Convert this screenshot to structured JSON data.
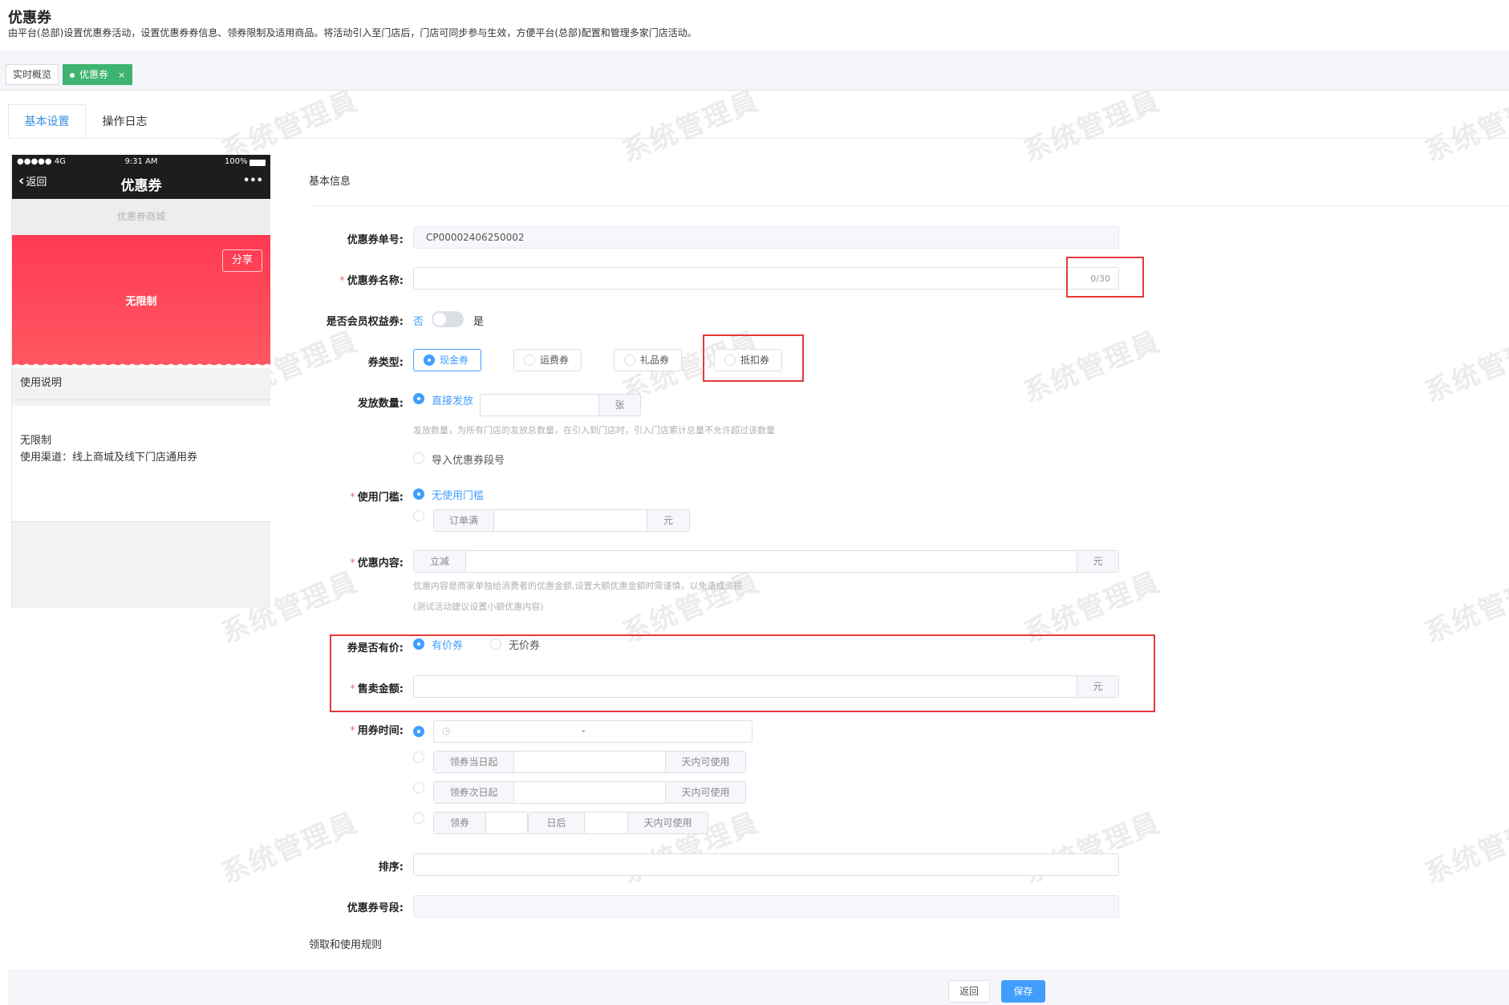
{
  "header": {
    "title": "优惠券",
    "description": "由平台(总部)设置优惠券活动，设置优惠券券信息、领券限制及适用商品。将活动引入至门店后，门店可同步参与生效，方便平台(总部)配置和管理多家门店活动。"
  },
  "view_tabs": [
    {
      "label": "实时概览"
    },
    {
      "label": "优惠券",
      "close": "×"
    }
  ],
  "tabs": [
    "基本设置",
    "操作日志"
  ],
  "watermark": "系统管理員",
  "phone": {
    "carrier": "●●●●● 4G",
    "time": "9:31 AM",
    "battery": "100%",
    "back": "返回",
    "title": "优惠券",
    "more": "•••",
    "subtitle": "优惠券商城",
    "share": "分享",
    "coupon_text": "无限制",
    "usage_title": "使用说明",
    "usage_lines": [
      "无限制",
      "使用渠道：线上商城及线下门店通用券"
    ]
  },
  "form": {
    "section_basic": "基本信息",
    "coupon_no": {
      "label": "优惠券单号:",
      "value": "CP00002406250002"
    },
    "coupon_name": {
      "label": "优惠券名称:",
      "value": "",
      "counter": "0/30"
    },
    "member": {
      "label": "是否会员权益券:",
      "off": "否",
      "on": "是"
    },
    "type": {
      "label": "券类型:",
      "options": [
        "现金券",
        "运费券",
        "礼品券",
        "抵扣券"
      ]
    },
    "quantity": {
      "label": "发放数量:",
      "opt1": "直接发放",
      "unit": "张",
      "tip": "发放数量，为所有门店的发放总数量，在引入到门店时，引入门店累计总量不允许超过该数量",
      "opt2": "导入优惠券段号"
    },
    "threshold": {
      "label": "使用门槛:",
      "opt1": "无使用门槛",
      "prefix": "订单满",
      "unit": "元"
    },
    "content": {
      "label": "优惠内容:",
      "prefix": "立减",
      "unit": "元",
      "tip1": "优惠内容是商家单独给消费者的优惠金额,设置大额优惠金额时需谨慎，以免造成资损",
      "tip2": "(测试活动建议设置小额优惠内容)"
    },
    "paid": {
      "label": "券是否有价:",
      "opt1": "有价券",
      "opt2": "无价券"
    },
    "price": {
      "label": "售卖金额:",
      "unit": "元"
    },
    "time": {
      "label": "用券时间:",
      "range_sep": "-",
      "opt2_prefix": "领券当日起",
      "opt2_suffix": "天内可使用",
      "opt3_prefix": "领券次日起",
      "opt3_suffix": "天内可使用",
      "opt4_a": "领券",
      "opt4_b": "日后",
      "opt4_c": "天内可使用"
    },
    "sort": {
      "label": "排序:"
    },
    "segment": {
      "label": "优惠券号段:"
    },
    "section_rules": "领取和使用规则"
  },
  "footer": {
    "back": "返回",
    "save": "保存"
  },
  "colors": {
    "accent": "#409eff",
    "green": "#3db36f",
    "red_highlight": "#e4393c",
    "coupon": "#ff4658"
  }
}
